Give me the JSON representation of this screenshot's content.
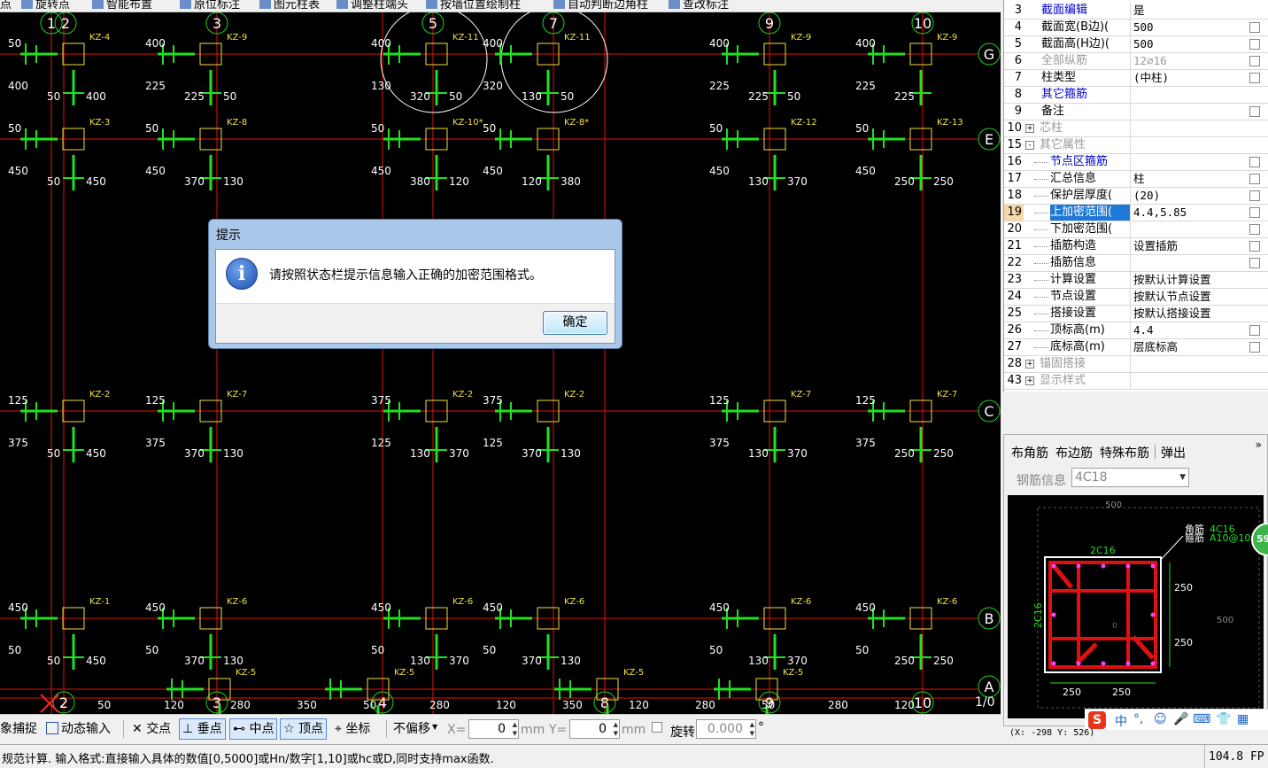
{
  "top_toolbar": {
    "items": [
      "点",
      "旋转点",
      "智能布置",
      "原位标注",
      "图元柱表",
      "调整柱端头",
      "按墙位置绘制柱",
      "自动判断边角柱",
      "查改标注"
    ]
  },
  "canvas": {
    "axis_top": [
      "1",
      "2",
      "3",
      "5",
      "7",
      "9",
      "10"
    ],
    "axis_bottom": [
      "2",
      "3",
      "4",
      "8",
      "9",
      "10"
    ],
    "axis_right": [
      "G",
      "E",
      "C",
      "B",
      "A"
    ],
    "axis_right_extra": "1/0",
    "columns": [
      {
        "row": "G",
        "tags": [
          "KZ-4",
          "KZ-9",
          "KZ-11",
          "KZ-11",
          "KZ-9",
          "KZ-9"
        ]
      },
      {
        "row": "E",
        "tags": [
          "KZ-3",
          "KZ-8",
          "KZ-10*",
          "KZ-8*",
          "KZ-12",
          "KZ-13"
        ]
      },
      {
        "row": "C",
        "tags": [
          "KZ-2",
          "KZ-7",
          "KZ-2",
          "KZ-2",
          "KZ-7",
          "KZ-7"
        ]
      },
      {
        "row": "B",
        "tags": [
          "KZ-1",
          "KZ-6",
          "KZ-6",
          "KZ-6",
          "KZ-6",
          "KZ-6"
        ]
      },
      {
        "row": "A",
        "tags": [
          "KZ-5",
          "KZ-5",
          "KZ-5",
          "KZ-5"
        ]
      }
    ],
    "dims": {
      "g_row": [
        "50",
        "400",
        "50",
        "400",
        "400",
        "225",
        "225",
        "50",
        "400",
        "130",
        "320",
        "50",
        "400",
        "320",
        "130",
        "50",
        "400",
        "225",
        "225",
        "50",
        "400",
        "225",
        "225"
      ],
      "e_row": [
        "50",
        "450",
        "50",
        "450",
        "50",
        "450",
        "370",
        "130",
        "50",
        "450",
        "380",
        "120",
        "50",
        "450",
        "120",
        "380",
        "50",
        "450",
        "130",
        "370",
        "50",
        "450",
        "250",
        "250"
      ],
      "c_row": [
        "125",
        "375",
        "50",
        "450",
        "125",
        "375",
        "370",
        "130",
        "375",
        "125",
        "130",
        "370",
        "375",
        "125",
        "370",
        "130",
        "125",
        "375",
        "130",
        "370",
        "125",
        "375",
        "250",
        "250"
      ],
      "b_row": [
        "450",
        "50",
        "50",
        "450",
        "450",
        "50",
        "370",
        "130",
        "450",
        "50",
        "130",
        "370",
        "450",
        "50",
        "370",
        "130",
        "450",
        "50",
        "130",
        "370",
        "450",
        "50",
        "250",
        "250"
      ],
      "a_row": [
        "50",
        "120",
        "280",
        "350",
        "50",
        "280",
        "120",
        "350",
        "120",
        "280",
        "50",
        "280",
        "120"
      ]
    }
  },
  "dialog": {
    "title": "提示",
    "message": "请按照状态栏提示信息输入正确的加密范围格式。",
    "ok_label": "确定"
  },
  "properties": [
    {
      "num": "3",
      "name": "截面编辑",
      "value": "是",
      "name_style": "blue",
      "indent": 1,
      "check": false
    },
    {
      "num": "4",
      "name": "截面宽(B边)(",
      "value": "500",
      "name_style": "",
      "indent": 1,
      "check": true
    },
    {
      "num": "5",
      "name": "截面高(H边)(",
      "value": "500",
      "name_style": "",
      "indent": 1,
      "check": true
    },
    {
      "num": "6",
      "name": "全部纵筋",
      "value": "12⌀16",
      "name_style": "gray",
      "value_style": "gray",
      "indent": 1,
      "check": true
    },
    {
      "num": "7",
      "name": "柱类型",
      "value": "(中柱)",
      "name_style": "",
      "indent": 1,
      "check": true
    },
    {
      "num": "8",
      "name": "其它箍筋",
      "value": "",
      "name_style": "blue",
      "indent": 1,
      "check": false
    },
    {
      "num": "9",
      "name": "备注",
      "value": "",
      "name_style": "",
      "indent": 1,
      "check": true
    },
    {
      "num": "10",
      "name": "芯柱",
      "value": "",
      "name_style": "gray",
      "indent": 0,
      "expander": "+",
      "check": false
    },
    {
      "num": "15",
      "name": "其它属性",
      "value": "",
      "name_style": "gray",
      "indent": 0,
      "expander": "-",
      "check": false
    },
    {
      "num": "16",
      "name": "节点区箍筋",
      "value": "",
      "name_style": "blue",
      "indent": 2,
      "check": true
    },
    {
      "num": "17",
      "name": "汇总信息",
      "value": "柱",
      "name_style": "",
      "indent": 2,
      "check": true
    },
    {
      "num": "18",
      "name": "保护层厚度(",
      "value": "(20)",
      "name_style": "",
      "indent": 2,
      "check": true
    },
    {
      "num": "19",
      "name": "上加密范围(",
      "value": "4.4,5.85",
      "name_style": "hl",
      "indent": 2,
      "check": true,
      "selected": true
    },
    {
      "num": "20",
      "name": "下加密范围(",
      "value": "",
      "name_style": "",
      "indent": 2,
      "check": true
    },
    {
      "num": "21",
      "name": "插筋构造",
      "value": "设置插筋",
      "name_style": "",
      "indent": 2,
      "check": true
    },
    {
      "num": "22",
      "name": "插筋信息",
      "value": "",
      "name_style": "",
      "indent": 2,
      "check": true
    },
    {
      "num": "23",
      "name": "计算设置",
      "value": "按默认计算设置",
      "name_style": "",
      "indent": 2,
      "check": false
    },
    {
      "num": "24",
      "name": "节点设置",
      "value": "按默认节点设置",
      "name_style": "",
      "indent": 2,
      "check": false
    },
    {
      "num": "25",
      "name": "搭接设置",
      "value": "按默认搭接设置",
      "name_style": "",
      "indent": 2,
      "check": false
    },
    {
      "num": "26",
      "name": "顶标高(m)",
      "value": "4.4",
      "name_style": "",
      "indent": 2,
      "check": true
    },
    {
      "num": "27",
      "name": "底标高(m)",
      "value": "层底标高",
      "name_style": "",
      "indent": 2,
      "check": true
    },
    {
      "num": "28",
      "name": "锚固搭接",
      "value": "",
      "name_style": "gray",
      "indent": 0,
      "expander": "+",
      "check": false
    },
    {
      "num": "43",
      "name": "显示样式",
      "value": "",
      "name_style": "gray",
      "indent": 0,
      "expander": "+",
      "check": false
    }
  ],
  "rebar_panel": {
    "tabs": [
      "布角筋",
      "布边筋",
      "特殊布筋",
      "弹出"
    ],
    "more": "»",
    "info_label": "钢筋信息",
    "info_value": "4C18",
    "drawing": {
      "top_dim": "500",
      "right_dim": "500",
      "corner_label": "角筋",
      "corner_value": "4C16",
      "stirrup_label": "箍筋",
      "stirrup_value": "A10@100",
      "top_edge": "2C16",
      "left_edge": "2C16",
      "side_dims": [
        "250",
        "250"
      ],
      "bottom_dims": [
        "250",
        "250"
      ],
      "center_mark": "0"
    },
    "badge": "59"
  },
  "ime": {
    "logo": "S",
    "items": [
      "中",
      "°,",
      "☺",
      "🎤",
      "⌨",
      "👕",
      "▦"
    ]
  },
  "coord_readout": "(X: -298 Y: 526)",
  "bottom_toolbar": {
    "osnap": "对象捕捉",
    "dynamic_input": "动态输入",
    "intersection": "交点",
    "perpendicular": "垂点",
    "midpoint": "中点",
    "vertex": "顶点",
    "coordinate": "坐标",
    "offset_mode": "不偏移",
    "x_label": "X=",
    "x_value": "0",
    "x_unit": "mm",
    "y_label": "Y=",
    "y_value": "0",
    "y_unit": "mm",
    "rotate_label": "旋转",
    "rotate_value": "0.000",
    "rotate_unit": "°"
  },
  "status_bar": {
    "message": "规范计算. 输入格式:直接输入具体的数值[0,5000]或Hn/数字[1,10]或hc或D,同时支持max函数.",
    "fps": "104.8 FP"
  }
}
